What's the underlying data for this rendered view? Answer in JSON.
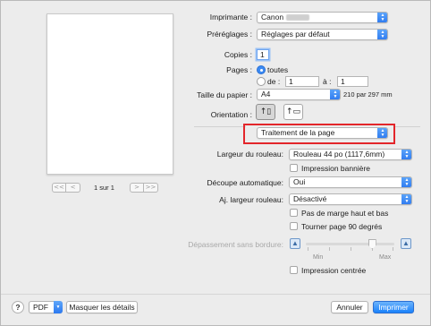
{
  "preview": {
    "pager": {
      "first": "<<",
      "prev": "<",
      "page_label": "1 sur 1",
      "next": ">",
      "last": ">>"
    }
  },
  "printer": {
    "label": "Imprimante :",
    "value": "Canon"
  },
  "presets": {
    "label": "Préréglages :",
    "value": "Réglages par défaut"
  },
  "copies": {
    "label": "Copies :",
    "value": "1"
  },
  "pages": {
    "label": "Pages :",
    "all_label": "toutes",
    "from_label": "de :",
    "from_value": "1",
    "to_label": "à :",
    "to_value": "1",
    "selected": "all"
  },
  "paper_size": {
    "label": "Taille du papier :",
    "value": "A4",
    "dimensions": "210 par 297 mm"
  },
  "orientation": {
    "label": "Orientation :",
    "selected": "portrait"
  },
  "section_popup": {
    "value": "Traitement de la page",
    "highlight_color": "#e3262b"
  },
  "roll_width": {
    "label": "Largeur du rouleau:",
    "value": "Rouleau 44 po (1117,6mm)"
  },
  "banner_print": {
    "label": "Impression bannière",
    "checked": false
  },
  "auto_cut": {
    "label": "Découpe automatique:",
    "value": "Oui"
  },
  "fit_roll_width": {
    "label": "Aj. largeur rouleau:",
    "value": "Désactivé"
  },
  "no_top_bottom_margin": {
    "label": "Pas de marge haut et bas",
    "checked": false
  },
  "rotate_90": {
    "label": "Tourner page 90 degrés",
    "checked": false
  },
  "borderless_extension": {
    "label": "Dépassement sans bordure:",
    "min_label": "Min",
    "max_label": "Max",
    "level": 0.75,
    "enabled": false
  },
  "center_print": {
    "label": "Impression centrée",
    "checked": false
  },
  "footer": {
    "help": "?",
    "pdf": "PDF",
    "hide_details": "Masquer les détails",
    "cancel": "Annuler",
    "print": "Imprimer"
  },
  "colors": {
    "accent": "#1a82fb"
  }
}
